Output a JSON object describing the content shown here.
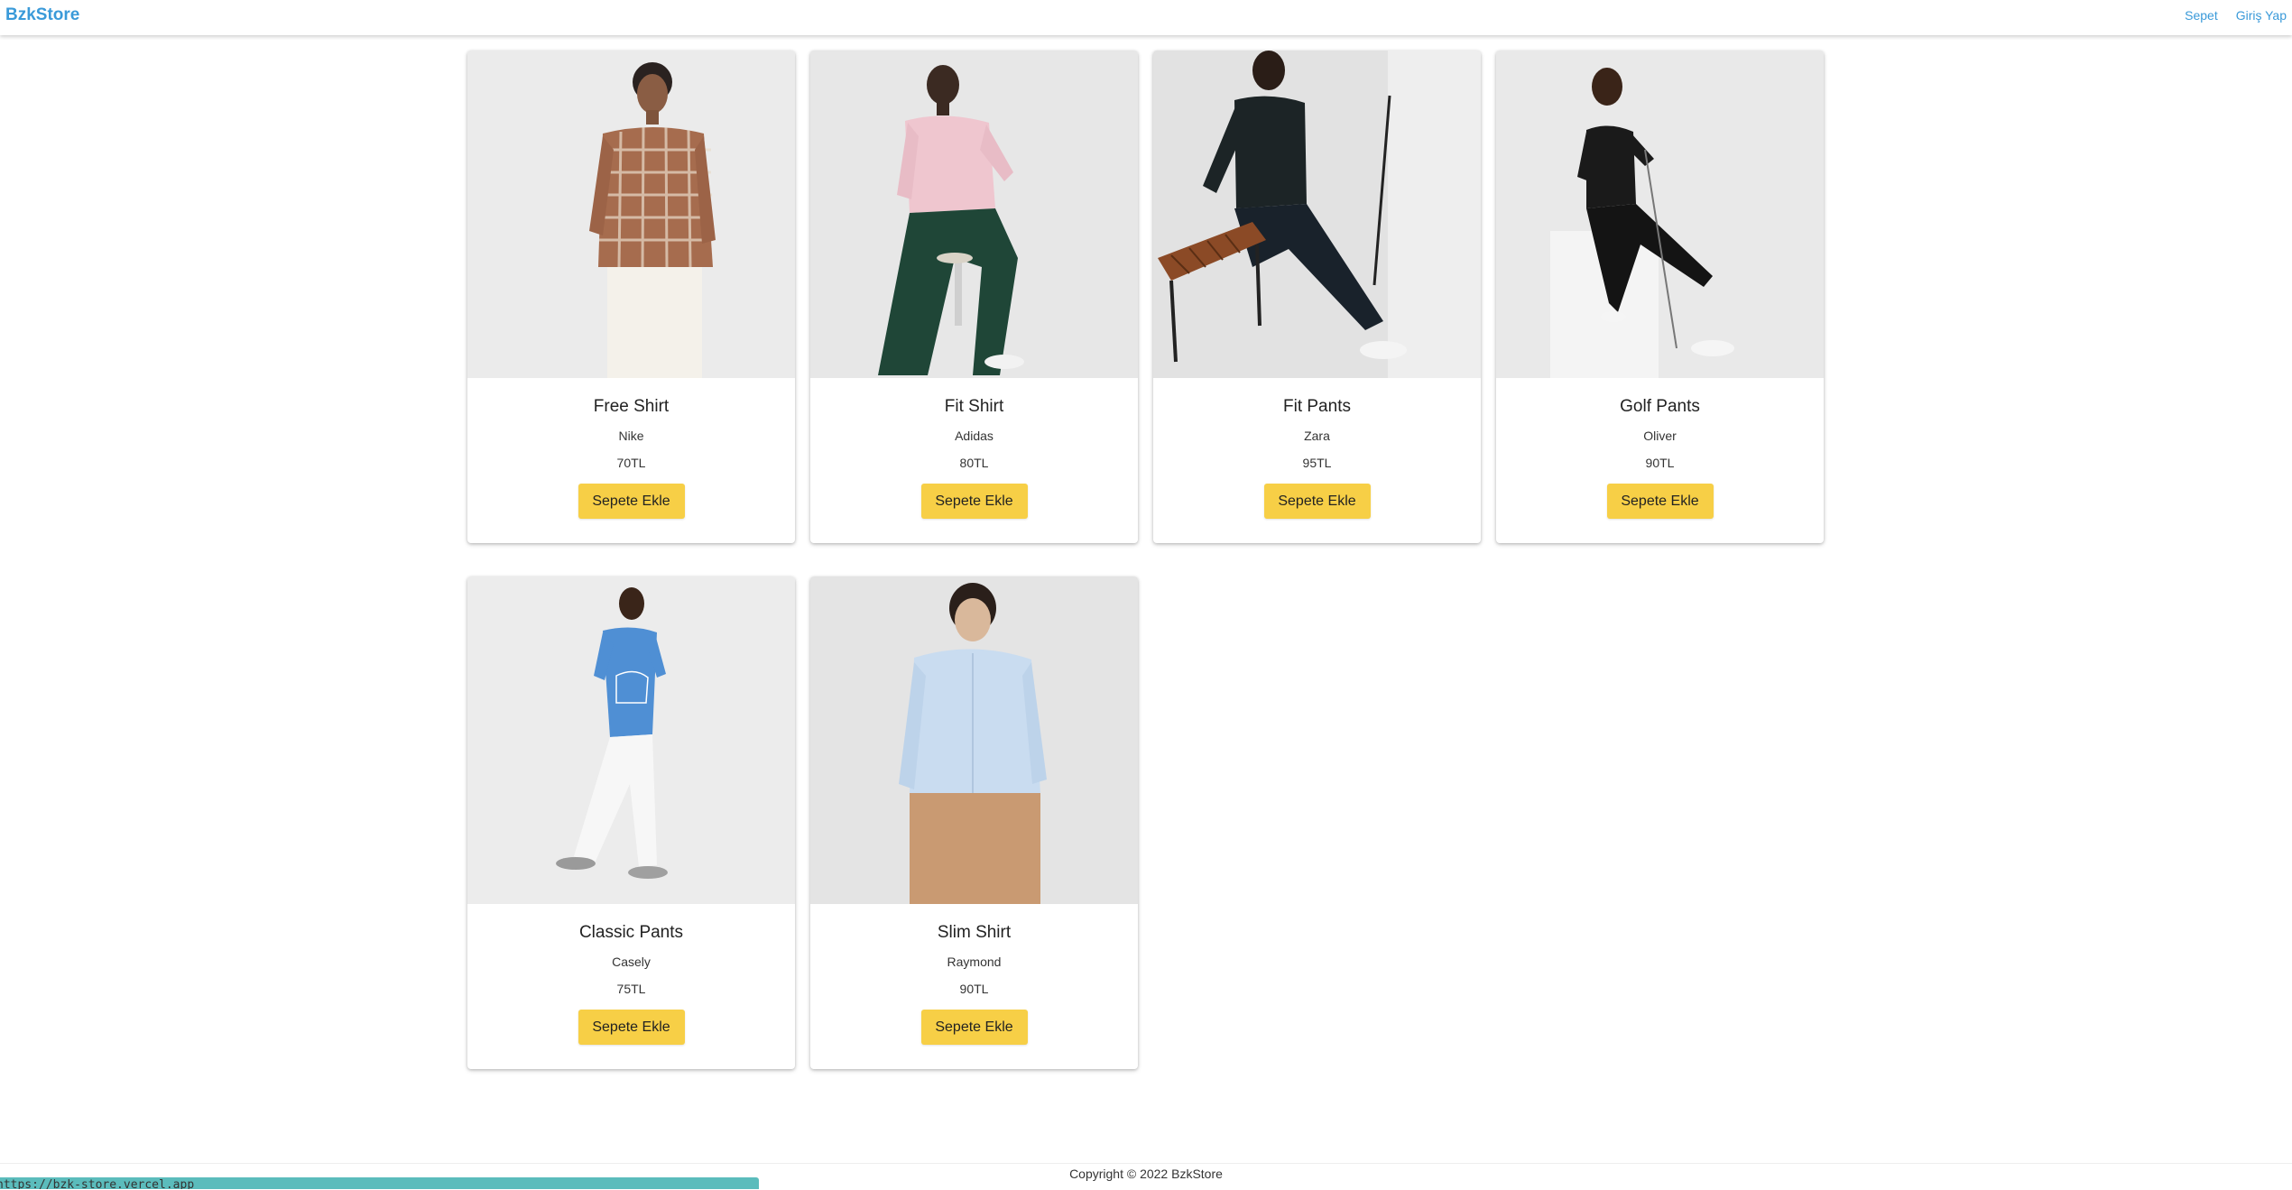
{
  "navbar": {
    "brand": "BzkStore",
    "links": [
      "Sepet",
      "Giriş Yap"
    ]
  },
  "products": [
    {
      "name": "Free Shirt",
      "brand": "Nike",
      "price": "70TL",
      "button": "Sepete Ekle",
      "image": "model-plaid-shirt"
    },
    {
      "name": "Fit Shirt",
      "brand": "Adidas",
      "price": "80TL",
      "button": "Sepete Ekle",
      "image": "model-pink-shirt"
    },
    {
      "name": "Fit Pants",
      "brand": "Zara",
      "price": "95TL",
      "button": "Sepete Ekle",
      "image": "model-dark-outfit-bench"
    },
    {
      "name": "Golf Pants",
      "brand": "Oliver",
      "price": "90TL",
      "button": "Sepete Ekle",
      "image": "model-golf-club"
    },
    {
      "name": "Classic Pants",
      "brand": "Casely",
      "price": "75TL",
      "button": "Sepete Ekle",
      "image": "model-blue-tee-walking"
    },
    {
      "name": "Slim Shirt",
      "brand": "Raymond",
      "price": "90TL",
      "button": "Sepete Ekle",
      "image": "model-light-blue-shirt"
    }
  ],
  "footer": {
    "copyright": "Copyright © 2022 BzkStore"
  },
  "status_bar": {
    "url": "https://bzk-store.vercel.app"
  },
  "colors": {
    "brand_blue": "#3a9ad9",
    "button_yellow": "#f7cf46",
    "status_teal": "#5bbcbc"
  }
}
